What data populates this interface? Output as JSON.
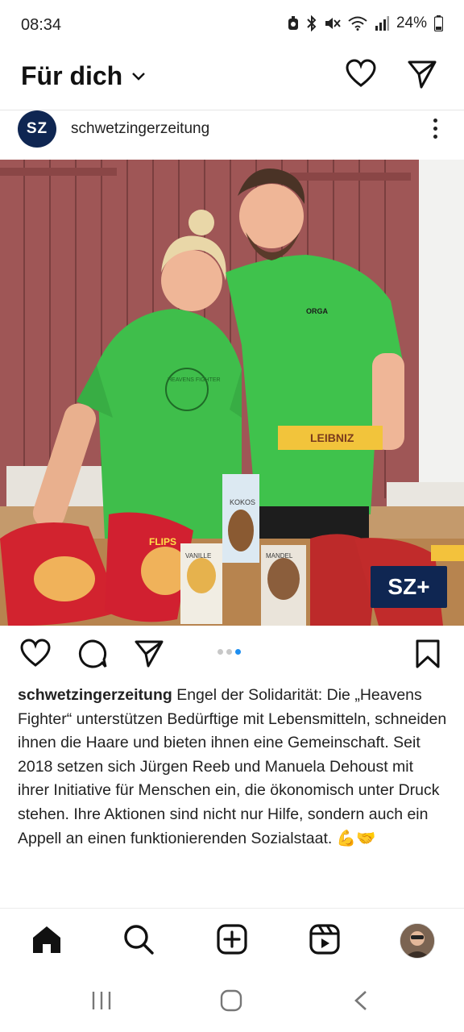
{
  "status_bar": {
    "time": "08:34",
    "battery": "24%",
    "icons": [
      "alarm-icon",
      "bluetooth-icon",
      "mute-icon",
      "wifi-icon",
      "signal-icon",
      "battery-icon"
    ]
  },
  "header": {
    "title": "Für dich",
    "icons": [
      "chevron-down-icon",
      "heart-icon",
      "send-icon"
    ]
  },
  "post": {
    "avatar_text": "SZ",
    "account": "schwetzingerzeitung",
    "badge": "SZ+",
    "image_text": {
      "shirt_left": "HEAVENS FIGHTER",
      "shirt_right": "ORGA",
      "package_center": "KOKOS",
      "package_left": "VANILLE",
      "package_right": "MANDEL",
      "chips": "FLIPS",
      "biscuits": "LEIBNIZ"
    },
    "carousel": {
      "count": 3,
      "active": 3
    },
    "caption_user": "schwetzingerzeitung",
    "caption_text": "Engel der Solidarität: Die „Heavens Fighter“ unterstützen Bedürftige mit Lebensmitteln, schneiden ihnen die Haare und bieten ihnen eine Gemeinschaft. Seit 2018 setzen sich Jürgen Reeb und Manuela Dehoust mit ihrer Initiative für Menschen ein, die ökonomisch unter Druck stehen. Ihre Aktionen sind nicht nur Hilfe, sondern auch ein Appell an einen funktionierenden Sozialstaat.",
    "caption_emojis": "💪🤝"
  },
  "bottom_nav": [
    "home-icon",
    "search-icon",
    "create-icon",
    "reels-icon",
    "profile-avatar"
  ],
  "system_nav": [
    "recent-apps-icon",
    "home-button-icon",
    "back-icon"
  ],
  "colors": {
    "brand_navy": "#0f2652",
    "carousel_active": "#1e8ef0",
    "shirt_green": "#3dbd4a",
    "barn_red": "#a85a5a"
  }
}
